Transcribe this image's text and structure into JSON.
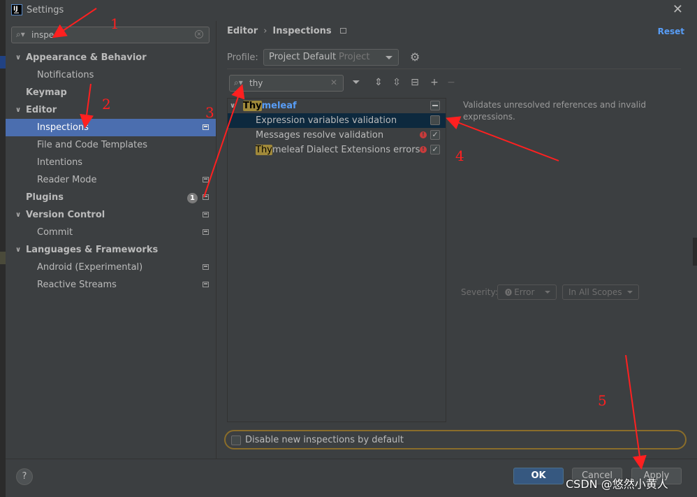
{
  "window": {
    "title": "Settings",
    "logo_text": "IJ",
    "close_glyph": "✕"
  },
  "left": {
    "search": {
      "value": "inspe",
      "placeholder": ""
    },
    "tree": [
      {
        "label": "Appearance & Behavior",
        "bold": true,
        "arrow": "∨",
        "child": false,
        "icon": false
      },
      {
        "label": "Notifications",
        "bold": false,
        "arrow": "",
        "child": true,
        "icon": false
      },
      {
        "label": "Keymap",
        "bold": true,
        "arrow": "",
        "child": false,
        "icon": false
      },
      {
        "label": "Editor",
        "bold": true,
        "arrow": "∨",
        "child": false,
        "icon": false
      },
      {
        "label": "Inspections",
        "bold": false,
        "arrow": "",
        "child": true,
        "icon": true,
        "selected": true
      },
      {
        "label": "File and Code Templates",
        "bold": false,
        "arrow": "",
        "child": true,
        "icon": false
      },
      {
        "label": "Intentions",
        "bold": false,
        "arrow": "",
        "child": true,
        "icon": false
      },
      {
        "label": "Reader Mode",
        "bold": false,
        "arrow": "",
        "child": true,
        "icon": true
      },
      {
        "label": "Plugins",
        "bold": true,
        "arrow": "",
        "child": false,
        "icon": true,
        "badge": "1"
      },
      {
        "label": "Version Control",
        "bold": true,
        "arrow": "∨",
        "child": false,
        "icon": true
      },
      {
        "label": "Commit",
        "bold": false,
        "arrow": "",
        "child": true,
        "icon": true
      },
      {
        "label": "Languages & Frameworks",
        "bold": true,
        "arrow": "∨",
        "child": false,
        "icon": false
      },
      {
        "label": "Android (Experimental)",
        "bold": false,
        "arrow": "",
        "child": true,
        "icon": true
      },
      {
        "label": "Reactive Streams",
        "bold": false,
        "arrow": "",
        "child": true,
        "icon": true
      }
    ]
  },
  "right": {
    "breadcrumb": {
      "parent": "Editor",
      "sep": "›",
      "current": "Inspections"
    },
    "reset_label": "Reset",
    "profile": {
      "label": "Profile:",
      "value": "Project Default",
      "scope": "Project"
    },
    "filter": {
      "value": "thy",
      "placeholder": ""
    },
    "inspections": {
      "group": {
        "match": "Thy",
        "rest": "meleaf"
      },
      "items": [
        {
          "label": "Expression variables validation",
          "match": "",
          "rest": "",
          "error": false,
          "checked": false,
          "highlight": true
        },
        {
          "label": "Messages resolve validation",
          "match": "",
          "rest": "",
          "error": true,
          "checked": true,
          "highlight": false
        },
        {
          "label": "",
          "match": "Thy",
          "rest": "meleaf Dialect Extensions errors",
          "error": true,
          "checked": true,
          "highlight": false
        }
      ]
    },
    "description": "Validates unresolved references and invalid expressions.",
    "severity": {
      "label": "Severity:",
      "value": "Error",
      "scope": "In All Scopes"
    },
    "disable_new_label": "Disable new inspections by default"
  },
  "footer": {
    "help": "?",
    "ok": "OK",
    "cancel": "Cancel",
    "apply": "Apply",
    "watermark": "CSDN @悠然小黄人"
  },
  "annotations": [
    "1",
    "2",
    "3",
    "4",
    "5"
  ],
  "colors": {
    "accent": "#589df6",
    "selection": "#4b6eaf",
    "ok_button": "#365880",
    "annotation": "#ff2020"
  }
}
